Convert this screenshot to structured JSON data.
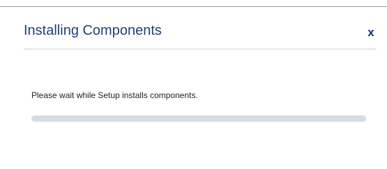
{
  "dialog": {
    "title": "Installing Components",
    "close_label": "x",
    "message": "Please wait while Setup installs components.",
    "progress": {
      "value": 0,
      "fill_color": "#2f5fa8",
      "track_color": "#d3dde6"
    }
  },
  "colors": {
    "title": "#1f3f7a",
    "close": "#13306a"
  }
}
